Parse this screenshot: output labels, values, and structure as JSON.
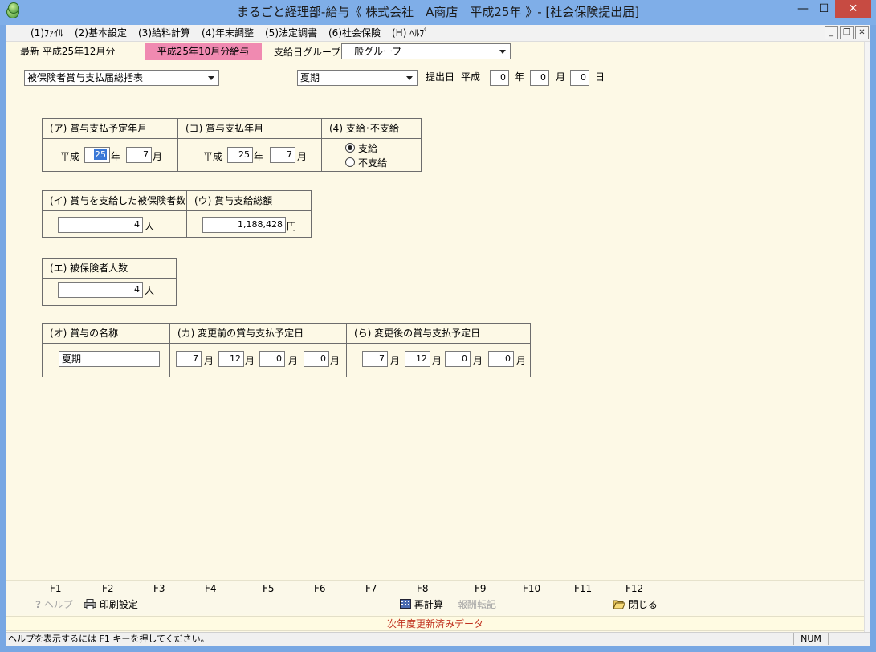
{
  "window": {
    "title": "まるごと経理部-給与《 株式会社　A商店　平成25年 》- [社会保険提出届]",
    "minimize": "—",
    "maximize": "☐",
    "close": "✕"
  },
  "menu": [
    "(1)ﾌｧｲﾙ",
    "(2)基本設定",
    "(3)給料計算",
    "(4)年末調整",
    "(5)法定調書",
    "(6)社会保険",
    "(H) ﾍﾙﾌﾟ"
  ],
  "mdi": {
    "minimize": "_",
    "restore": "❐",
    "close": "✕"
  },
  "toolbar": {
    "latest": "最新 平成25年12月分",
    "period": "平成25年10月分給与",
    "group_label": "支給日グループ",
    "group_value": "一般グループ"
  },
  "form_selector": "被保険者賞与支払届総括表",
  "bonus_selector": "夏期",
  "submission": {
    "label": "提出日",
    "era": "平成",
    "year": "0",
    "year_unit": "年",
    "month": "0",
    "month_unit": "月",
    "day": "0",
    "day_unit": "日"
  },
  "sections": {
    "a": {
      "title": "(ア) 賞与支払予定年月",
      "era": "平成",
      "year": "25",
      "year_unit": "年",
      "month": "7",
      "month_unit": "月"
    },
    "b": {
      "title": "(ヨ) 賞与支払年月",
      "era": "平成",
      "year": "25",
      "year_unit": "年",
      "month": "7",
      "month_unit": "月"
    },
    "c": {
      "title": "(4) 支給･不支給",
      "option_paid": "支給",
      "option_unpaid": "不支給"
    },
    "d": {
      "title": "(イ) 賞与を支給した被保険者数",
      "value": "4",
      "unit": "人"
    },
    "e": {
      "title": "(ウ) 賞与支給総額",
      "value": "1,188,428",
      "unit": "円"
    },
    "f": {
      "title": "(エ) 被保険者人数",
      "value": "4",
      "unit": "人"
    },
    "g": {
      "title": "(オ) 賞与の名称",
      "value": "夏期"
    },
    "h": {
      "title": "(カ) 変更前の賞与支払予定日",
      "m1": "7",
      "d1": "12",
      "m2": "0",
      "d2": "0",
      "u1": "月",
      "u2": "月",
      "u3": "月",
      "u4": "月"
    },
    "i": {
      "title": "(ら) 変更後の賞与支払予定日",
      "m1": "7",
      "d1": "12",
      "m2": "0",
      "d2": "0",
      "u1": "月",
      "u2": "月",
      "u3": "月",
      "u4": "月"
    }
  },
  "fkeys": {
    "labels": [
      "F1",
      "F2",
      "F3",
      "F4",
      "F5",
      "F6",
      "F7",
      "F8",
      "F9",
      "F10",
      "F11",
      "F12"
    ],
    "help": "ヘルプ",
    "print_setup": "印刷設定",
    "recalc": "再計算",
    "transfer": "報酬転記",
    "close": "閉じる"
  },
  "notice": "次年度更新済みデータ",
  "status": {
    "text": "ヘルプを表示するには F1 キーを押してください。",
    "num": "NUM"
  }
}
